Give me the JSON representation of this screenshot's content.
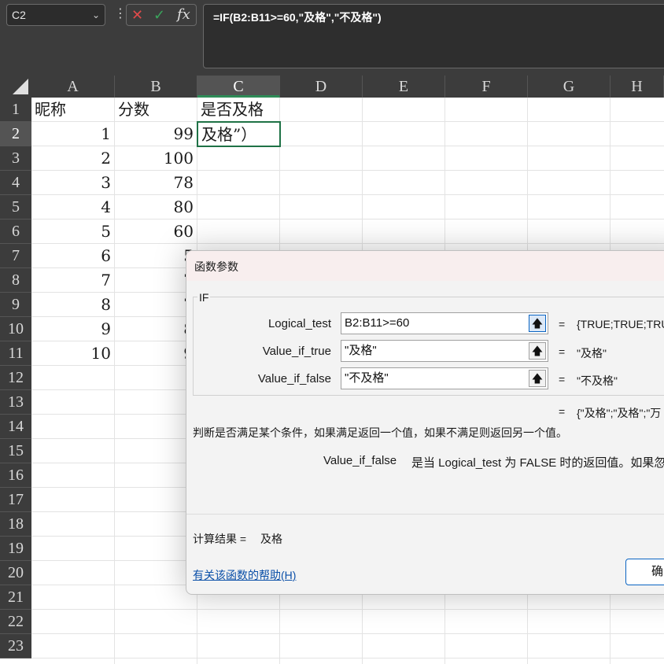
{
  "formula_bar": {
    "name_box": "C2",
    "formula": "=IF(B2:B11>=60,\"及格\",\"不及格\")"
  },
  "columns": [
    "A",
    "B",
    "C",
    "D",
    "E",
    "F",
    "G",
    "H"
  ],
  "rows": [
    "1",
    "2",
    "3",
    "4",
    "5",
    "6",
    "7",
    "8",
    "9",
    "10",
    "11",
    "12",
    "13",
    "14",
    "15",
    "16",
    "17",
    "18",
    "19",
    "20",
    "21",
    "22",
    "23"
  ],
  "cells": {
    "a1": "昵称",
    "b1": "分数",
    "c1": "是否及格",
    "c2": "及格”）",
    "a2": "1",
    "b2": "99",
    "a3": "2",
    "b3": "100",
    "a4": "3",
    "b4": "78",
    "a5": "4",
    "b5": "80",
    "a6": "5",
    "b6": "60",
    "a7": "6",
    "b7": "5",
    "a8": "7",
    "b8": "7",
    "a9": "8",
    "b9": "7",
    "a10": "9",
    "b10": "8",
    "a11": "10",
    "b11": "9"
  },
  "dialog": {
    "title": "函数参数",
    "function_name": "IF",
    "args": [
      {
        "name": "Logical_test",
        "value": "B2:B11>=60",
        "result": "{TRUE;TRUE;TRU"
      },
      {
        "name": "Value_if_true",
        "value": "\"及格\"",
        "result": "\"及格\""
      },
      {
        "name": "Value_if_false",
        "value": "\"不及格\"",
        "result": "\"不及格\""
      }
    ],
    "eq_sign": "=",
    "overall_result": "{\"及格\";\"及格\";\"万",
    "description": "判断是否满足某个条件，如果满足返回一个值，如果不满足则返回另一个值。",
    "arg_help_name": "Value_if_false",
    "arg_help_text": "是当 Logical_test 为 FALSE 时的返回值。如果忽",
    "calc_label": "计算结果 =",
    "calc_value": "及格",
    "help_link": "有关该函数的帮助(H)",
    "ok_button": "确"
  },
  "colors": {
    "header_bg": "#3c3c3c",
    "selection_green": "#1f7246",
    "cancel_red": "#e04a4a",
    "confirm_green": "#3aa55c"
  }
}
